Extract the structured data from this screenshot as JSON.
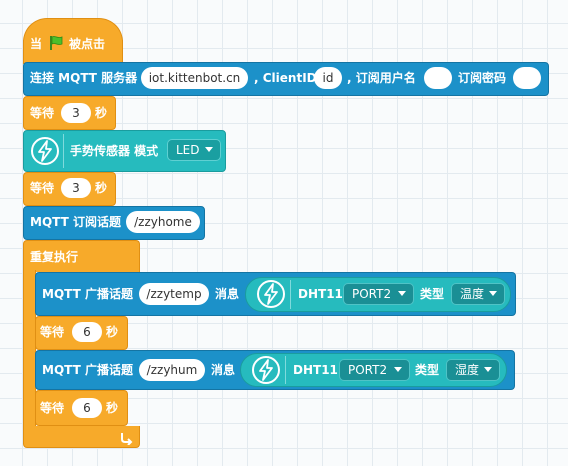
{
  "colors": {
    "control": "#f7aa2a",
    "iot": "#1c91c9",
    "sensor": "#26bbbe"
  },
  "hat": {
    "when": "当",
    "clicked": "被点击"
  },
  "connect": {
    "label": "连接 MQTT 服务器",
    "server": "iot.kittenbot.cn",
    "client_label": ", ClientID",
    "client_id": "id",
    "user_label": ", 订阅用户名",
    "user_value": "",
    "pwd_label": "订阅密码",
    "pwd_value": ""
  },
  "wait1": {
    "label": "等待",
    "value": "3",
    "unit": "秒"
  },
  "gesture": {
    "label": "手势传感器 模式",
    "mode": "LED"
  },
  "wait2": {
    "label": "等待",
    "value": "3",
    "unit": "秒"
  },
  "subscribe": {
    "label": "MQTT 订阅话题",
    "topic": "/zzyhome"
  },
  "repeat": {
    "label": "重复执行"
  },
  "pub1": {
    "label": "MQTT 广播话题",
    "topic": "/zzytemp",
    "msg_label": "消息",
    "sensor": "DHT11",
    "port": "PORT2",
    "type_label": "类型",
    "type": "温度"
  },
  "wait3": {
    "label": "等待",
    "value": "6",
    "unit": "秒"
  },
  "pub2": {
    "label": "MQTT 广播话题",
    "topic": "/zzyhum",
    "msg_label": "消息",
    "sensor": "DHT11",
    "port": "PORT2",
    "type_label": "类型",
    "type": "湿度"
  },
  "wait4": {
    "label": "等待",
    "value": "6",
    "unit": "秒"
  },
  "icons": {
    "flag": "green-flag-icon",
    "sensor": "lightning-icon",
    "loop": "loop-arrow-icon"
  }
}
